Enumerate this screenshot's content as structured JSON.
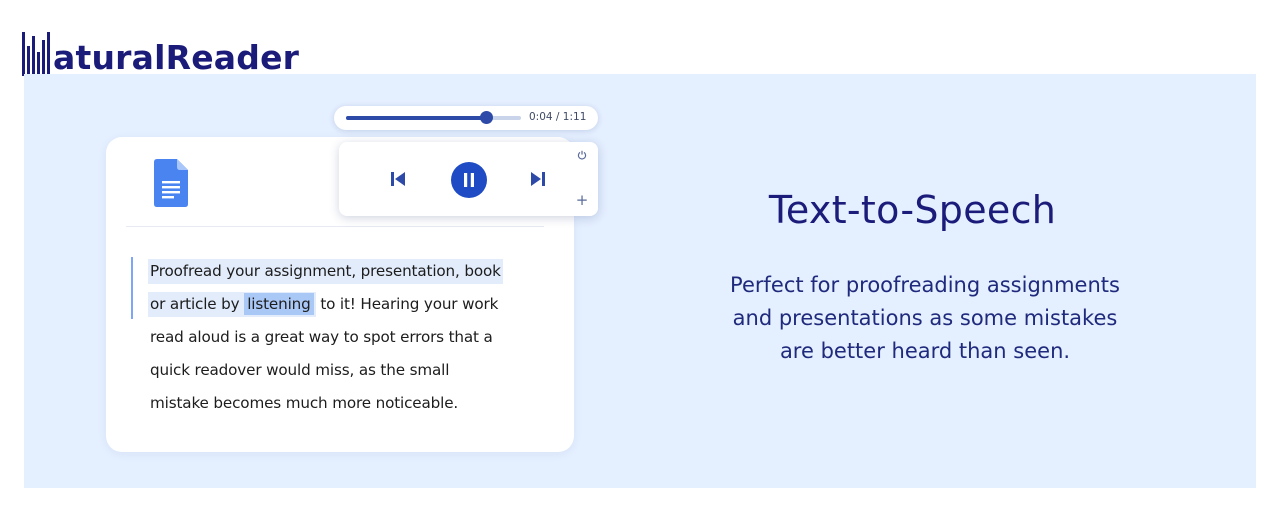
{
  "brand": {
    "logo_text": "aturalReader",
    "logo_mark": "N",
    "color": "#1b1b7a"
  },
  "document": {
    "icon": "google-docs-icon",
    "lines": [
      "Proofread your assignment, presentation, book",
      "or article by",
      "listening",
      "to it! Hearing your work",
      "read aloud is a great way to spot errors that a",
      "quick readover would miss, as the small",
      "mistake becomes much more noticeable."
    ]
  },
  "player": {
    "time": "0:04 / 1:11",
    "progress_fraction": 0.8,
    "prev_icon": "skip-previous-icon",
    "pause_icon": "pause-icon",
    "next_icon": "skip-next-icon",
    "power_icon": "power-icon",
    "add_label": "+",
    "accent": "#1f4cc4"
  },
  "feature": {
    "title": "Text-to-Speech",
    "description_lines": [
      "Perfect for proofreading assignments",
      "and presentations as some mistakes",
      "are better heard than seen."
    ]
  },
  "colors": {
    "panel_bg": "#e4efff",
    "highlight_line": "#e2ecfb",
    "highlight_word": "#aac8f6"
  }
}
